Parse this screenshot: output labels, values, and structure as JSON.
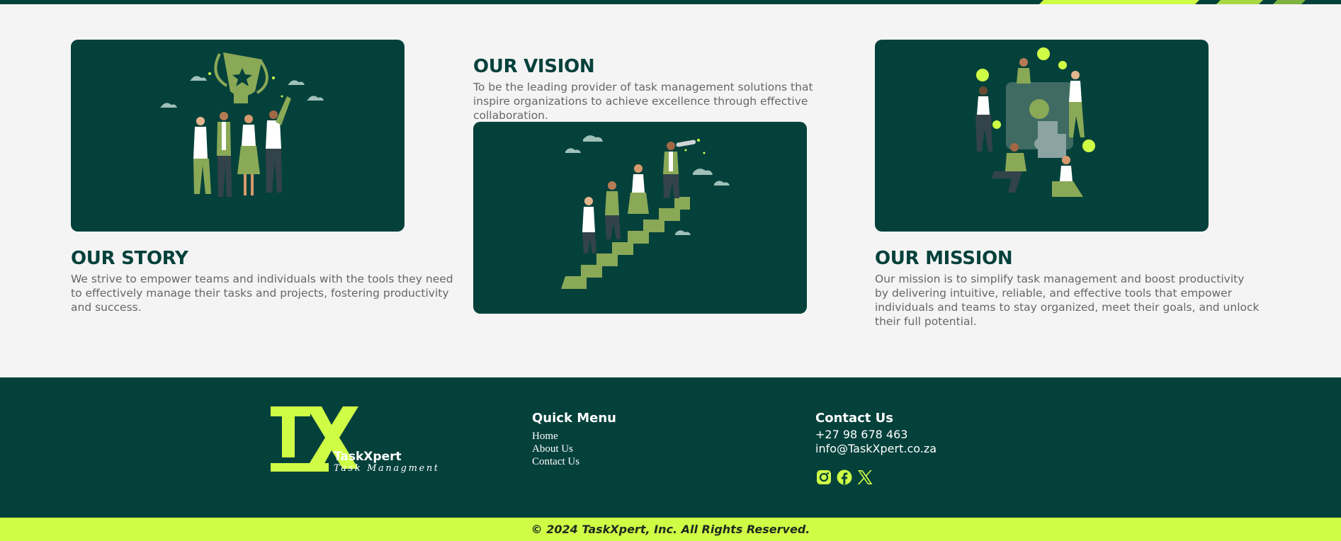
{
  "sections": {
    "story": {
      "title": "OUR STORY",
      "body": "We strive to empower teams and individuals with the tools they need to effectively manage their tasks and projects, fostering productivity and success."
    },
    "vision": {
      "title": "OUR VISION",
      "body": "To be the leading provider of task management solutions that inspire organizations to achieve excellence through effective collaboration."
    },
    "mission": {
      "title": "OUR MISSION",
      "body": "Our mission is to simplify task management and boost productivity by delivering intuitive, reliable, and effective tools that empower individuals and teams to stay organized, meet their goals, and unlock their full potential."
    }
  },
  "footer": {
    "brand": {
      "name": "TaskXpert",
      "tagline": "Task Managment",
      "logo_letters": "TX"
    },
    "quick_menu": {
      "title": "Quick Menu",
      "items": [
        "Home",
        "About Us",
        "Contact Us"
      ]
    },
    "contact": {
      "title": "Contact Us",
      "phone": "+27 98 678 463",
      "email": "info@TaskXpert.co.za",
      "social": [
        "instagram-icon",
        "facebook-icon",
        "x-icon"
      ]
    },
    "copyright": "© 2024 TaskXpert, Inc. All Rights Reserved."
  },
  "colors": {
    "primary": "#05413b",
    "accent": "#cffd46",
    "illustration_green": "#8aa957",
    "background": "#f4f4f4"
  }
}
